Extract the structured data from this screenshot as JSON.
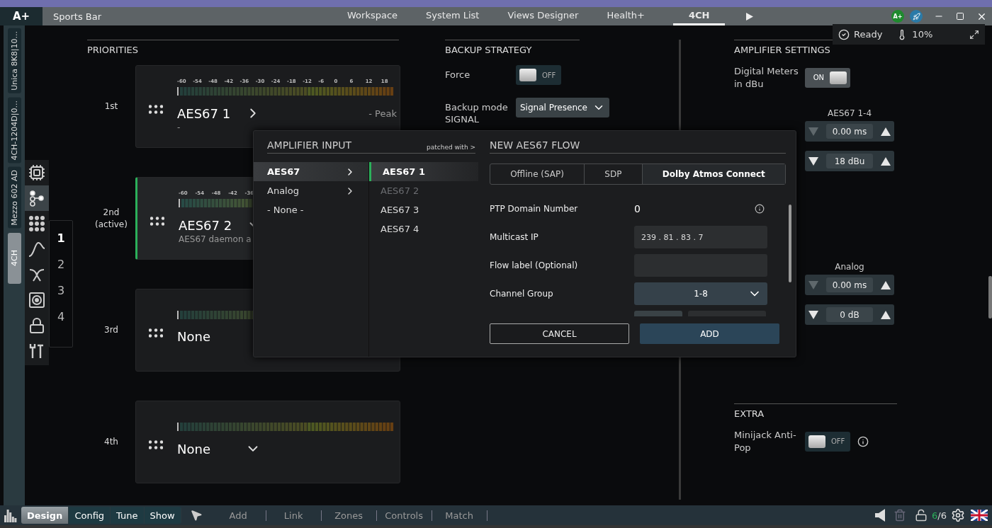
{
  "app": {
    "logo": "A+",
    "title": "Sports Bar",
    "account_badge": "A+"
  },
  "nav_tabs": [
    {
      "label": "Workspace",
      "selected": false
    },
    {
      "label": "System List",
      "selected": false
    },
    {
      "label": "Views Designer",
      "selected": false
    },
    {
      "label": "Health+",
      "selected": false
    },
    {
      "label": "4CH",
      "selected": true
    }
  ],
  "status": {
    "state": "Ready",
    "temperature": "10%"
  },
  "devices": [
    {
      "label": "Unica 8K8|10...",
      "selected": false
    },
    {
      "label": "4CH-1204D|0...",
      "selected": false
    },
    {
      "label": "Mezzo 602 AD",
      "selected": false
    },
    {
      "label": "4CH",
      "selected": true
    }
  ],
  "tools": [
    {
      "kind": "chip",
      "selected": false
    },
    {
      "kind": "routing",
      "selected": true
    },
    {
      "kind": "matrix",
      "selected": false
    },
    {
      "kind": "curve",
      "selected": false
    },
    {
      "kind": "crossover",
      "selected": false
    },
    {
      "kind": "speaker",
      "selected": false
    },
    {
      "kind": "lock",
      "selected": false
    },
    {
      "kind": "tools",
      "selected": false
    }
  ],
  "channels": [
    {
      "label": "1",
      "selected": true
    },
    {
      "label": "2",
      "selected": false
    },
    {
      "label": "3",
      "selected": false
    },
    {
      "label": "4",
      "selected": false
    }
  ],
  "priorities": {
    "title": "PRIORITIES",
    "rows": [
      {
        "rank": "1st",
        "active": false,
        "source": "AES67 1",
        "expanded": false,
        "detail": "-",
        "peak": "- Peak",
        "scale": [
          "-60",
          "-54",
          "-48",
          "-42",
          "-36",
          "-30",
          "-24",
          "-18",
          "-12",
          "-6",
          "0",
          "6",
          "12",
          "18"
        ]
      },
      {
        "rank": "2nd\n(active)",
        "active": true,
        "source": "AES67 2",
        "expanded": true,
        "detail": "AES67 daemon a",
        "scale": [
          "-60",
          "-54",
          "-48",
          "-42",
          "-36"
        ]
      },
      {
        "rank": "3rd",
        "active": false,
        "source": "None"
      },
      {
        "rank": "4th",
        "active": false,
        "source": "None",
        "expanded": true
      }
    ]
  },
  "backup": {
    "title": "BACKUP STRATEGY",
    "force": {
      "label": "Force",
      "on": false,
      "text": "OFF"
    },
    "mode": {
      "label": "Backup mode",
      "value": "Signal Presence"
    },
    "signal": {
      "label": "SIGNAL"
    }
  },
  "amplifier": {
    "title": "AMPLIFIER SETTINGS",
    "digital_meters": {
      "label": "Digital Meters in dBu",
      "on": true,
      "text": "ON"
    },
    "groups": [
      {
        "title": "AES67 1-4",
        "steppers": [
          {
            "value": "0.00 ms",
            "down_disabled": true
          },
          {
            "value": "18 dBu",
            "down_disabled": false
          }
        ]
      },
      {
        "title": "Analog",
        "steppers": [
          {
            "value": "0.00 ms",
            "down_disabled": true
          },
          {
            "value": "0 dB",
            "down_disabled": false
          }
        ]
      }
    ]
  },
  "extra": {
    "title": "EXTRA",
    "minijack": {
      "label": "Minijack Anti-Pop",
      "on": false,
      "text": "OFF"
    }
  },
  "input_panel": {
    "title": "AMPLIFIER INPUT",
    "link": "patched with >",
    "categories": [
      {
        "label": "AES67",
        "selected": true,
        "has_submenu": true
      },
      {
        "label": "Analog",
        "selected": false,
        "has_submenu": true
      },
      {
        "label": "- None -",
        "selected": false,
        "has_submenu": false
      }
    ],
    "sources": [
      {
        "label": "AES67 1",
        "selected": true,
        "disabled": false
      },
      {
        "label": "AES67 2",
        "selected": false,
        "disabled": true
      },
      {
        "label": "AES67 3",
        "selected": false,
        "disabled": false
      },
      {
        "label": "AES67 4",
        "selected": false,
        "disabled": false
      }
    ]
  },
  "flow_panel": {
    "title": "NEW AES67 FLOW",
    "tabs": [
      {
        "label": "Offline (SAP)",
        "selected": false
      },
      {
        "label": "SDP",
        "selected": false
      },
      {
        "label": "Dolby Atmos Connect",
        "selected": true
      }
    ],
    "fields": [
      {
        "kind": "text",
        "label": "PTP Domain Number",
        "value": "0",
        "info": true
      },
      {
        "kind": "input",
        "label": "Multicast IP",
        "value": "239 . 81 . 83 . 7"
      },
      {
        "kind": "input",
        "label": "Flow label (Optional)"
      },
      {
        "kind": "select",
        "label": "Channel Group",
        "value": "1-8"
      }
    ],
    "cancel": "CANCEL",
    "add": "ADD"
  },
  "bottom_bar": {
    "modes": [
      {
        "label": "Design",
        "selected": true
      },
      {
        "label": "Config",
        "selected": false
      },
      {
        "label": "Tune",
        "selected": false
      },
      {
        "label": "Show",
        "selected": false
      }
    ],
    "tools": [
      "Add",
      "Link",
      "Zones",
      "Controls",
      "Match"
    ],
    "counter": {
      "online": "6",
      "total": "/6"
    }
  }
}
